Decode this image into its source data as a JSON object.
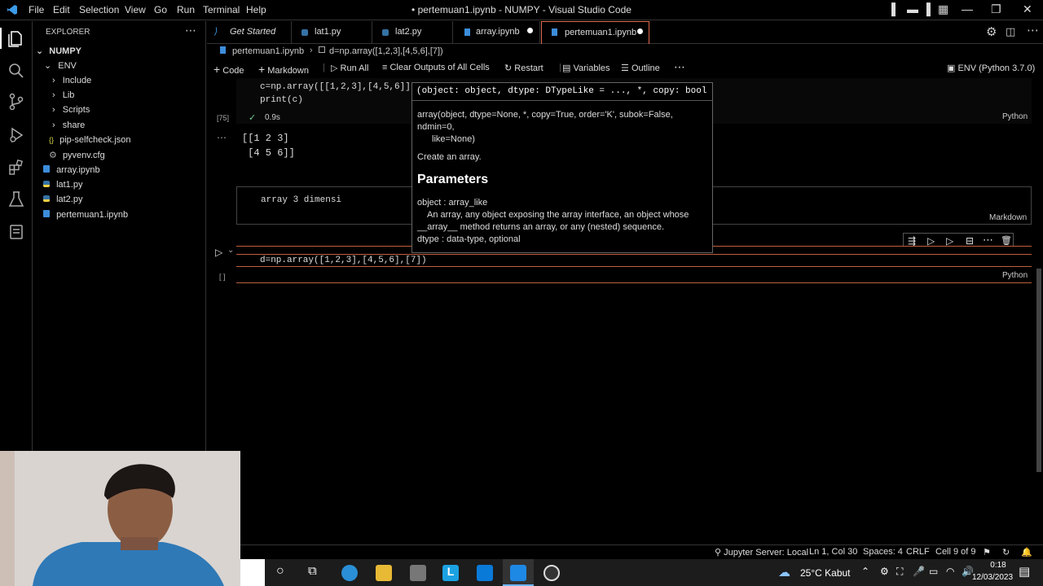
{
  "titlebar": {
    "menu": [
      "File",
      "Edit",
      "Selection",
      "View",
      "Go",
      "Run",
      "Terminal",
      "Help"
    ],
    "title": "• pertemuan1.ipynb - NUMPY - Visual Studio Code"
  },
  "sidebar": {
    "header": "EXPLORER",
    "root": "NUMPY",
    "items": [
      {
        "label": "ENV",
        "kind": "folder-open"
      },
      {
        "label": "Include",
        "kind": "folder"
      },
      {
        "label": "Lib",
        "kind": "folder"
      },
      {
        "label": "Scripts",
        "kind": "folder"
      },
      {
        "label": "share",
        "kind": "folder"
      },
      {
        "label": "pip-selfcheck.json",
        "kind": "json"
      },
      {
        "label": "pyvenv.cfg",
        "kind": "cfg"
      },
      {
        "label": "array.ipynb",
        "kind": "notebook"
      },
      {
        "label": "lat1.py",
        "kind": "python"
      },
      {
        "label": "lat2.py",
        "kind": "python"
      },
      {
        "label": "pertemuan1.ipynb",
        "kind": "notebook"
      }
    ]
  },
  "tabs": [
    {
      "label": "Get Started"
    },
    {
      "label": "lat1.py"
    },
    {
      "label": "lat2.py"
    },
    {
      "label": "array.ipynb"
    },
    {
      "label": "pertemuan1.ipynb"
    }
  ],
  "breadcrumb": {
    "file": "pertemuan1.ipynb",
    "cell": "d=np.array([1,2,3],[4,5,6],[7])"
  },
  "toolbar": {
    "code": "Code",
    "markdown": "Markdown",
    "run_all": "Run All",
    "clear": "Clear Outputs of All Cells",
    "restart": "Restart",
    "variables": "Variables",
    "outline": "Outline",
    "kernel": "ENV (Python 3.7.0)"
  },
  "cells": {
    "cell1": {
      "line1": "c=np.array([[1,2,3],[4,5,6]])",
      "line2": "print(c)",
      "exec": "[75]",
      "time": "0.9s",
      "lang": "Python",
      "out1": "[[1 2 3]",
      "out2": " [4 5 6]]"
    },
    "cell2": {
      "text": "array 3 dimensi",
      "lang": "Markdown"
    },
    "cell3": {
      "code": "d=np.array([1,2,3],[4,5,6],[7])",
      "exec": "[ ]",
      "lang": "Python"
    }
  },
  "hover": {
    "signature": "(object: object, dtype: DTypeLike = ..., *, copy: bool = ",
    "line1": "array(object, dtype=None, *, copy=True, order='K', subok=False,",
    "line2": "ndmin=0,",
    "line3": "like=None)",
    "desc": "Create an array.",
    "params_title": "Parameters",
    "p1": "object : array_like",
    "p2": "An array, any object exposing the array interface, an object whose",
    "p3": "__array__ method returns an array, or any (nested) sequence.",
    "p4": "dtype : data-type, optional"
  },
  "status": {
    "jupyter": "Jupyter Server: Local",
    "pos": "Ln 1, Col 30",
    "spaces": "Spaces: 4",
    "eol": "CRLF",
    "cell": "Cell 9 of 9"
  },
  "taskbar": {
    "weather": "25°C Kabut",
    "time": "0:18",
    "date": "12/03/2023"
  },
  "colors": {
    "accent": "#e06c4b",
    "python_blue": "#3572A5",
    "folder": "#cccccc"
  }
}
